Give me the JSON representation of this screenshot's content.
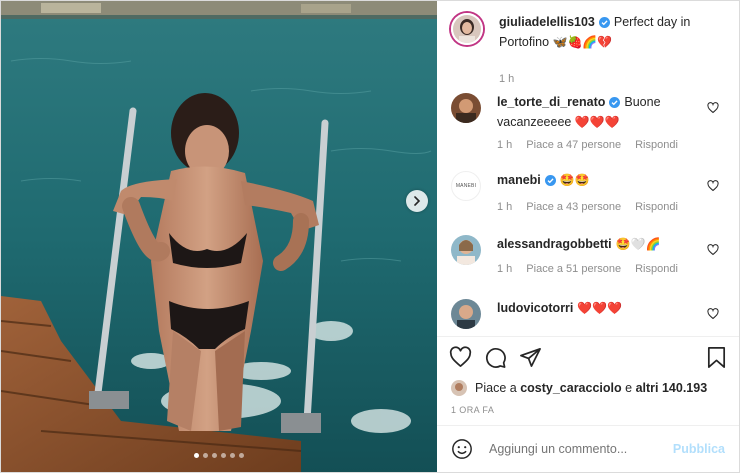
{
  "post": {
    "owner": "giuliadelellis103",
    "caption": "Perfect day in Portofino",
    "caption_emoji": "🦋🍓🌈💔",
    "time": "1 h"
  },
  "comments": [
    {
      "user": "le_torte_di_renato",
      "verified": true,
      "text": "Buone vacanzeeeee",
      "emoji": "❤️❤️❤️",
      "time": "1 h",
      "likes": "Piace a 47 persone",
      "reply": "Rispondi"
    },
    {
      "user": "manebi",
      "verified": true,
      "text": "",
      "emoji": "🤩🤩",
      "time": "1 h",
      "likes": "Piace a 43 persone",
      "reply": "Rispondi",
      "avatar_text": "MANEBI"
    },
    {
      "user": "alessandragobbetti",
      "verified": false,
      "text": "",
      "emoji": "🤩🤍🌈",
      "time": "1 h",
      "likes": "Piace a 51 persone",
      "reply": "Rispondi"
    },
    {
      "user": "ludovicotorri",
      "verified": false,
      "text": "",
      "emoji": "❤️❤️❤️"
    }
  ],
  "liked_by": {
    "prefix": "Piace a",
    "user": "costy_caracciolo",
    "middle": "e",
    "others": "altri 140.193"
  },
  "timestamp": "1 ORA FA",
  "composer": {
    "placeholder": "Aggiungi un commento...",
    "publish": "Pubblica"
  },
  "carousel": {
    "count": 6,
    "active_index": 0
  },
  "icons": {
    "like": "heart-icon",
    "comment": "comment-icon",
    "share": "paper-plane-icon",
    "save": "bookmark-icon",
    "next": "chevron-right-icon",
    "emoji": "smiley-icon",
    "verified": "verified-badge-icon"
  },
  "colors": {
    "verified": "#3897f0",
    "publish": "#b2dffc",
    "story_ring": "#c13584",
    "meta": "#8e8e8e"
  }
}
